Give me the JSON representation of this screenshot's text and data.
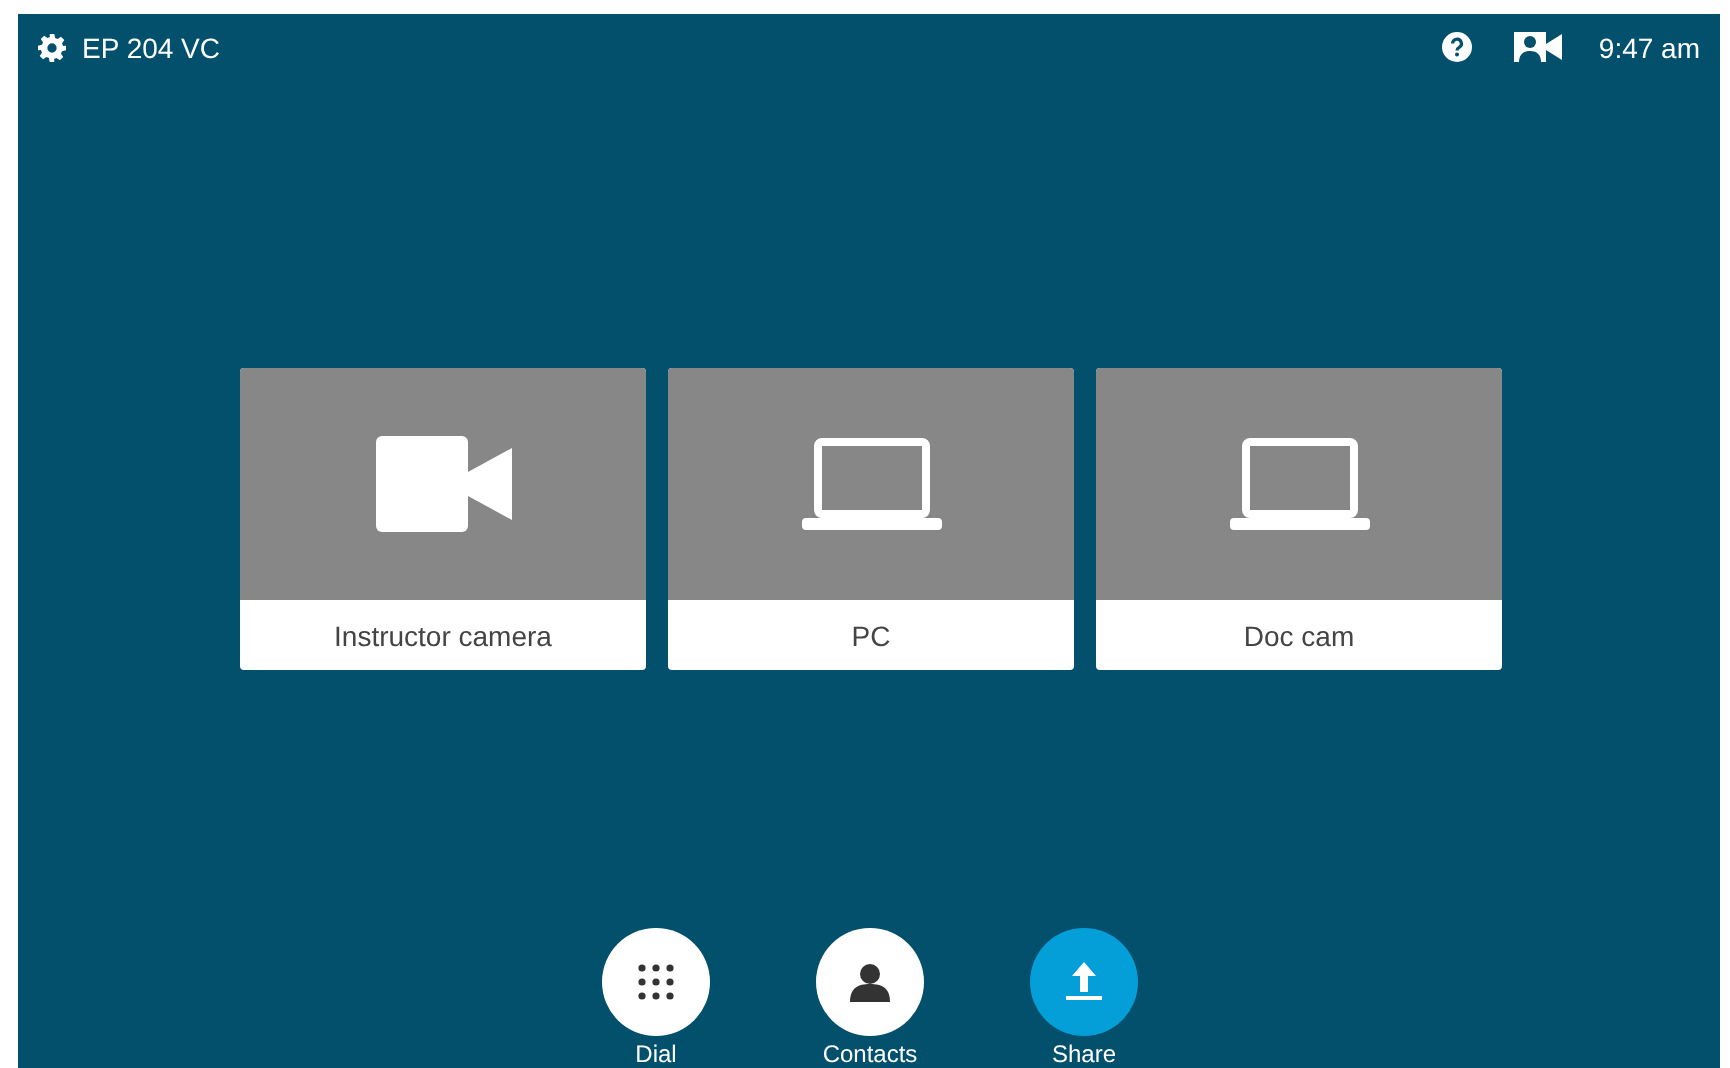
{
  "top_bar": {
    "title": "EP 204 VC",
    "time": "9:47 am"
  },
  "sources": [
    {
      "label": "Instructor camera",
      "kind": "camera"
    },
    {
      "label": "PC",
      "kind": "laptop"
    },
    {
      "label": "Doc cam",
      "kind": "laptop"
    }
  ],
  "actions": [
    {
      "label": "Dial",
      "kind": "dial"
    },
    {
      "label": "Contacts",
      "kind": "contacts"
    },
    {
      "label": "Share",
      "kind": "share"
    }
  ]
}
